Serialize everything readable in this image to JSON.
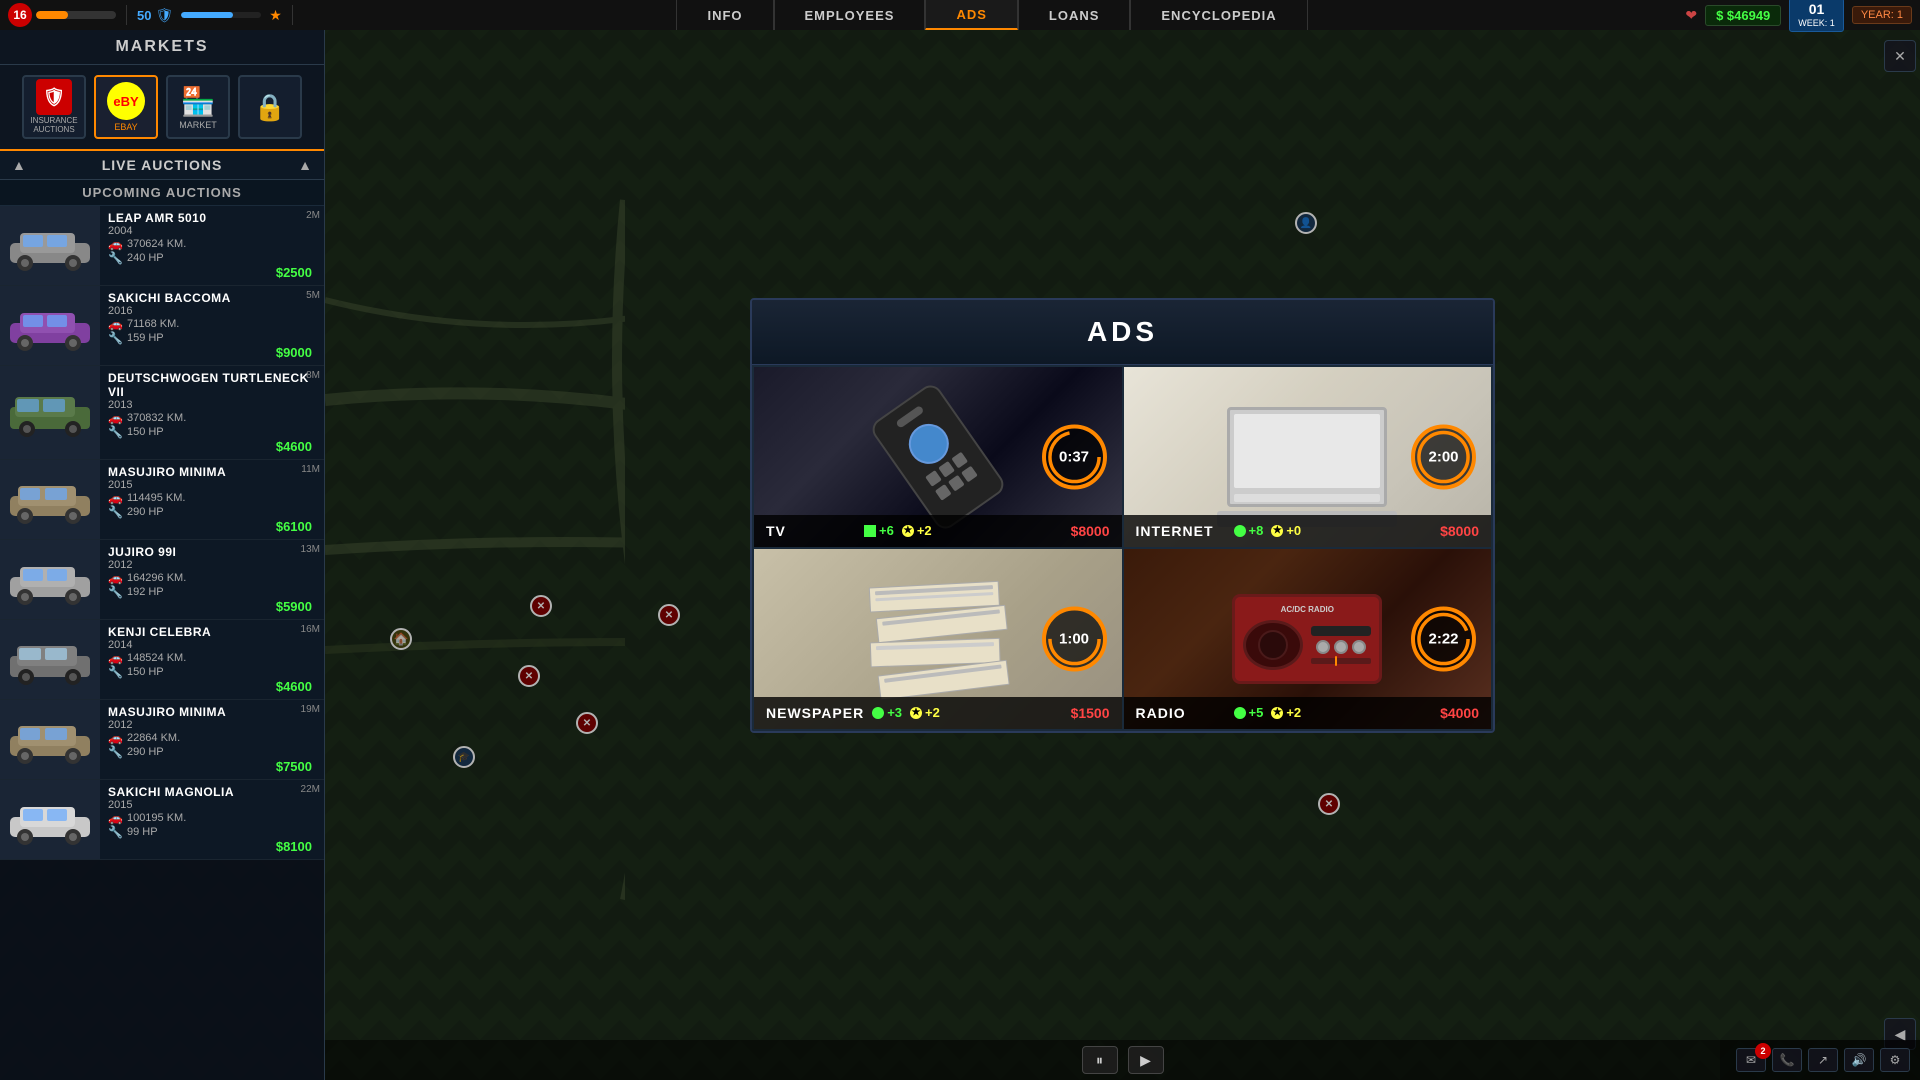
{
  "topbar": {
    "level": "16",
    "xp_fill": "40",
    "shield_count": "50",
    "money": "$46949",
    "week_label": "WEEK: 1",
    "week_num": "01",
    "year_label": "YEAR: 1",
    "nav_items": [
      {
        "id": "info",
        "label": "INFO",
        "active": false
      },
      {
        "id": "employees",
        "label": "EMPLOYEES",
        "active": false
      },
      {
        "id": "ads",
        "label": "ADS",
        "active": true
      },
      {
        "id": "loans",
        "label": "LOANS",
        "active": false
      },
      {
        "id": "encyclopedia",
        "label": "ENCYCLOPEDIA",
        "active": false
      }
    ]
  },
  "sidebar": {
    "markets_label": "MARKETS",
    "market_icons": [
      {
        "id": "insurance",
        "label": "INSURANCE AUCTIONS",
        "symbol": "🛡"
      },
      {
        "id": "ebay",
        "label": "EBAY",
        "symbol": "eBY",
        "active": true
      },
      {
        "id": "market",
        "label": "MARKET",
        "symbol": "🏪"
      },
      {
        "id": "locked",
        "label": "",
        "symbol": "🔒"
      }
    ],
    "live_auctions_label": "LIVE AUCTIONS",
    "upcoming_label": "UPCOMING AUCTIONS",
    "cars": [
      {
        "id": 1,
        "name": "LEAP AMR 5010",
        "year": "2004",
        "km": "370624 KM.",
        "hp": "240 HP",
        "price": "$2500",
        "bid_id": "2M",
        "color": "gray"
      },
      {
        "id": 2,
        "name": "SAKICHI BACCOMA",
        "year": "2016",
        "km": "71168 KM.",
        "hp": "159 HP",
        "price": "$9000",
        "bid_id": "5M",
        "color": "purple"
      },
      {
        "id": 3,
        "name": "DEUTSCHWOGEN TURTLENECK VII",
        "year": "2013",
        "km": "370832 KM.",
        "hp": "150 HP",
        "price": "$4600",
        "bid_id": "8M",
        "color": "green"
      },
      {
        "id": 4,
        "name": "MASUJIRO MINIMA",
        "year": "2015",
        "km": "114495 KM.",
        "hp": "290 HP",
        "price": "$6100",
        "bid_id": "11M",
        "color": "beige"
      },
      {
        "id": 5,
        "name": "JUJIRO 99I",
        "year": "2012",
        "km": "164296 KM.",
        "hp": "192 HP",
        "price": "$5900",
        "bid_id": "13M",
        "color": "silver"
      },
      {
        "id": 6,
        "name": "KENJI CELEBRA",
        "year": "2014",
        "km": "148524 KM.",
        "hp": "150 HP",
        "price": "$4600",
        "bid_id": "16M",
        "color": "gray"
      },
      {
        "id": 7,
        "name": "MASUJIRO MINIMA",
        "year": "2012",
        "km": "22864 KM.",
        "hp": "290 HP",
        "price": "$7500",
        "bid_id": "19M",
        "color": "beige"
      },
      {
        "id": 8,
        "name": "SAKICHI MAGNOLIA",
        "year": "2015",
        "km": "100195 KM.",
        "hp": "99 HP",
        "price": "$8100",
        "bid_id": "22M",
        "color": "white"
      }
    ]
  },
  "ads": {
    "title": "ADS",
    "cards": [
      {
        "id": "tv",
        "name": "TV",
        "timer": "0:37",
        "stat1_icon": "green",
        "stat1_val": "+6",
        "stat2_icon": "yellow",
        "stat2_val": "+2",
        "price": "$8000",
        "price_color": "#f44"
      },
      {
        "id": "internet",
        "name": "INTERNET",
        "timer": "2:00",
        "stat1_icon": "green",
        "stat1_val": "+8",
        "stat2_icon": "yellow",
        "stat2_val": "+0",
        "price": "$8000",
        "price_color": "#f44"
      },
      {
        "id": "newspaper",
        "name": "NEWSPAPER",
        "timer": "1:00",
        "stat1_icon": "green",
        "stat1_val": "+3",
        "stat2_icon": "yellow",
        "stat2_val": "+2",
        "price": "$1500",
        "price_color": "#f44"
      },
      {
        "id": "radio",
        "name": "RADIO",
        "timer": "2:22",
        "stat1_icon": "green",
        "stat1_val": "+5",
        "stat2_icon": "yellow",
        "stat2_val": "+2",
        "price": "$4000",
        "price_color": "#f44"
      }
    ]
  },
  "bottom_controls": {
    "pause_label": "⏸",
    "play_label": "▶"
  }
}
